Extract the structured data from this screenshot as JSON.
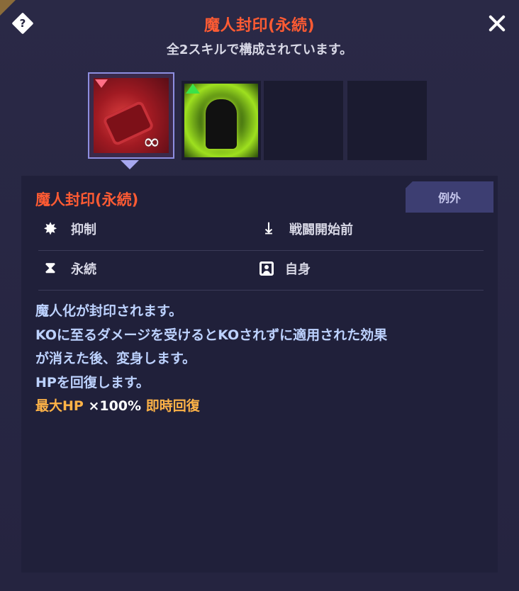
{
  "header": {
    "title": "魔人封印(永続)",
    "subtitle": "全2スキルで構成されています。"
  },
  "skill_slots": [
    {
      "name": "魔人封印(永続)",
      "selected": true,
      "type": "debuff",
      "icon": "chained-gauntlet-infinity-icon"
    },
    {
      "name": "",
      "selected": false,
      "type": "buff",
      "icon": "green-aura-warrior-icon"
    },
    {
      "name": "",
      "selected": false,
      "type": "empty"
    },
    {
      "name": "",
      "selected": false,
      "type": "empty"
    }
  ],
  "detail": {
    "title": "魔人封印(永続)",
    "badge": "例外",
    "attributes": {
      "category": {
        "label": "抑制",
        "icon": "suppress-icon"
      },
      "timing": {
        "label": "戦闘開始前",
        "icon": "download-icon"
      },
      "duration": {
        "label": "永続",
        "icon": "hourglass-icon"
      },
      "target": {
        "label": "自身",
        "icon": "self-target-icon"
      }
    },
    "description": {
      "line1": "魔人化が封印されます。",
      "line2": "KOに至るダメージを受けるとKOされずに適用された効果",
      "line3": "が消えた後、変身します。",
      "line4": "HPを回復します。",
      "effect": {
        "stat": "最大HP",
        "multiplier": " ×100% ",
        "type": "即時回復"
      }
    }
  },
  "colors": {
    "title": "#ff5b33",
    "description": "#bdd2ff",
    "highlight": "#ffb347",
    "background": "#24233f"
  }
}
